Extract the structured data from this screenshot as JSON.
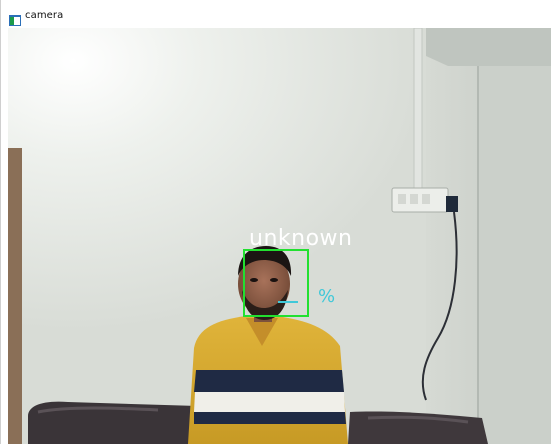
{
  "window": {
    "title": "camera"
  },
  "overlay": {
    "face_label": "unknown",
    "confidence_text": "%",
    "box_color": "#22e030",
    "label_color": "#ffffff",
    "confidence_color": "#40c8d8"
  }
}
